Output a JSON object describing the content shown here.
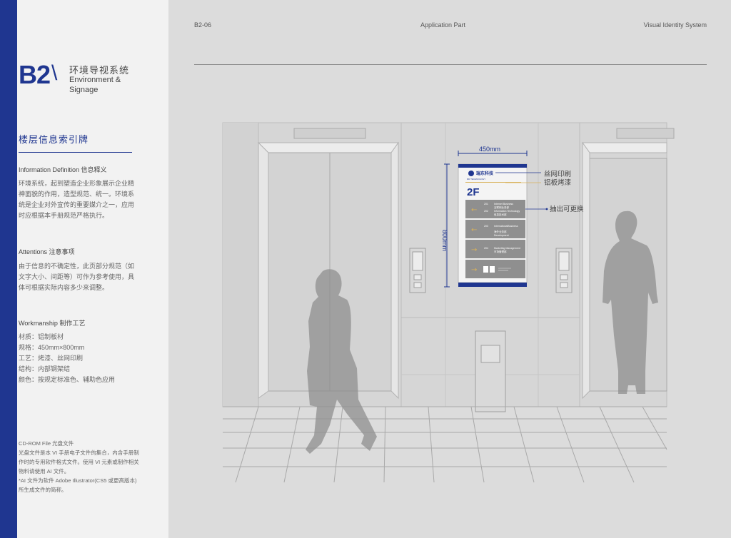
{
  "header": {
    "code": "B2-06",
    "part": "Application Part",
    "system": "Visual Identity System"
  },
  "category": {
    "code": "B2",
    "zh": "环境导视系统",
    "en": "Environment & Signage"
  },
  "section": {
    "title": "楼层信息索引牌",
    "info_heading": "Information Definition 信息释义",
    "info_body": "环境系统，起到塑造企业形象展示企业精神面貌的作用，造型规范、统一。环境系统是企业对外宣传的重要媒介之一，应用时应根据本手册规范严格执行。",
    "attn_heading": "Attentions 注意事项",
    "attn_body": "由于信息的不确定性，此页部分规范（如文字大小、间距等）可作为参考使用，具体可根据实际内容多少来调整。",
    "work_heading": "Workmanship  制作工艺",
    "work_lines": [
      "材质：铝制板材",
      "规格：450mm×800mm",
      "工艺：烤漆、丝网印刷",
      "结构：内部钢架结",
      "颜色：按规定标准色、辅助色应用"
    ]
  },
  "footer": {
    "title": "CD-ROM File 光盘文件",
    "body": "光盘文件是本 VI 手册电子文件的集合，内含手册制作时的专用软件格式文件。使用 VI 元素或制作相关物料请使用 AI 文件。",
    "note": "*AI 文件为软件 Adobe Illustrator(CS5 或更高版本) 所生成文件的简称。"
  },
  "sign": {
    "width_label": "450mm",
    "height_label": "800mm",
    "logo_text": "瑞东科技",
    "logo_sub": "RD TECHNOLOGY",
    "floor": "2F",
    "rows": [
      {
        "arrow": "←",
        "room1": "201",
        "l1": "Internet Business",
        "l1zh": "互联网业务部",
        "room2": "202",
        "l2": "Information Technology",
        "l2zh": "信息技术部"
      },
      {
        "arrow": "←",
        "room1": "203",
        "l1": "InternationalBusiness",
        "l1zh": "海外业务部",
        "room2": "",
        "l2": "Development",
        "l2zh": ""
      },
      {
        "arrow": "→",
        "room1": "204",
        "l1": "Marketing Management",
        "l1zh": "市场管理部",
        "room2": "",
        "l2": "",
        "l2zh": ""
      },
      {
        "arrow": "→",
        "room1": "",
        "l1": "",
        "l1zh": "",
        "room2": "",
        "l2": "",
        "l2zh": ""
      }
    ],
    "callouts": {
      "silk": "丝网印刷",
      "paint": "铝板烤漆",
      "removable": "抽出可更换"
    }
  },
  "colors": {
    "brand_blue": "#1f3690",
    "accent_gold": "#d8b25a",
    "panel_gray": "#8f8f8f"
  }
}
